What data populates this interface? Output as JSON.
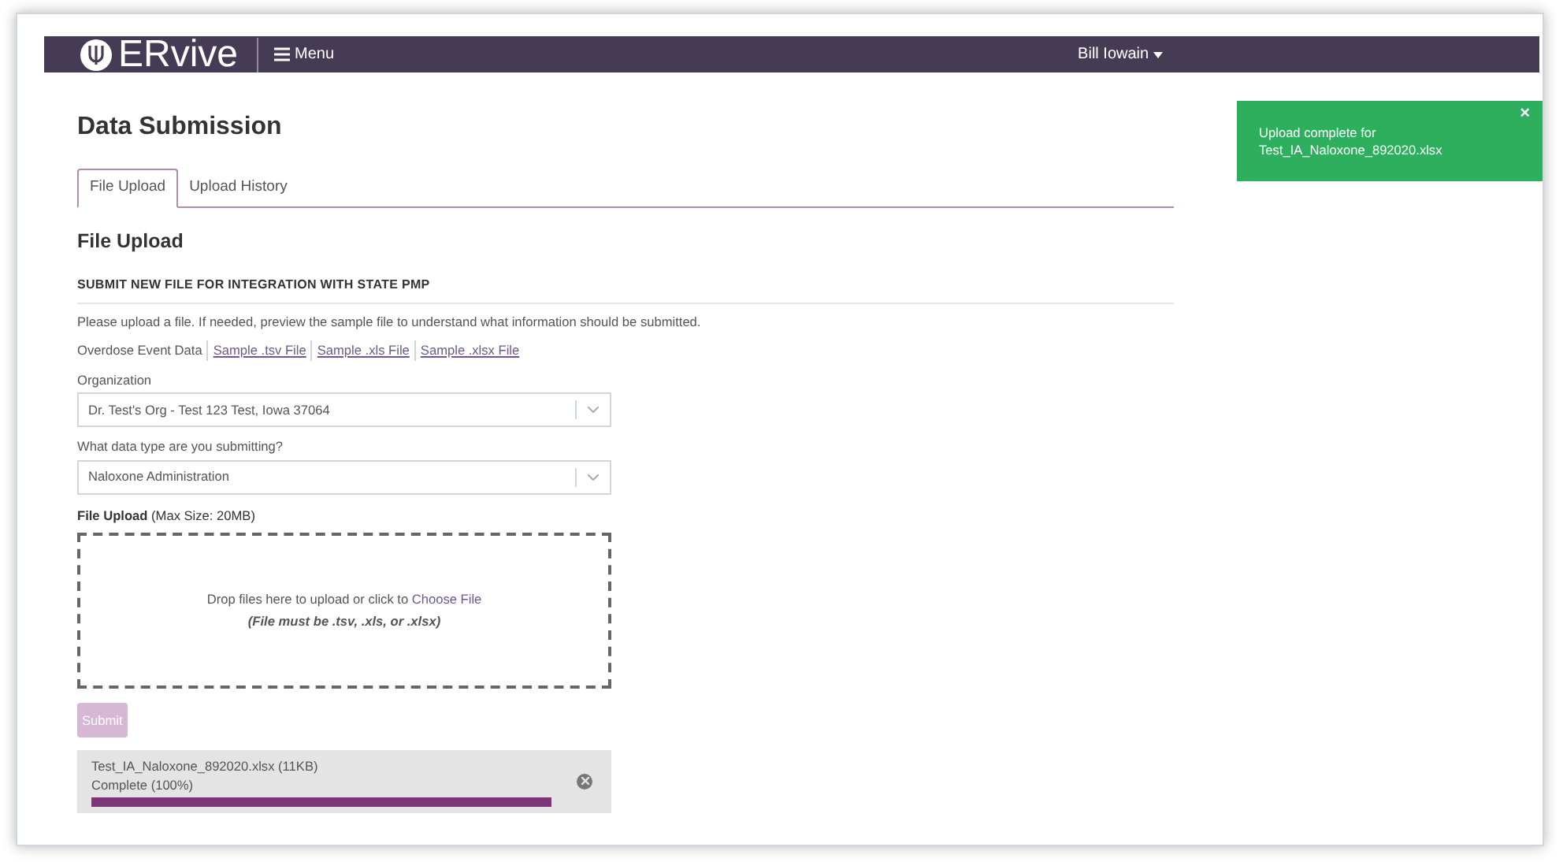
{
  "navbar": {
    "logo": "ERvive",
    "menu": "Menu",
    "user": "Bill Iowain"
  },
  "page_title": "Data Submission",
  "tabs": [
    {
      "label": "File Upload",
      "selected": true
    },
    {
      "label": "Upload History",
      "selected": false
    }
  ],
  "section_title": "File Upload",
  "subheading": "SUBMIT NEW FILE FOR INTEGRATION WITH STATE PMP",
  "intro": "Please upload a file. If needed, preview the sample file to understand what information should be submitted.",
  "sample_row": {
    "label": "Overdose Event Data",
    "links": [
      "Sample .tsv File",
      "Sample .xls File",
      "Sample .xlsx File"
    ]
  },
  "fields": [
    {
      "label": "Organization",
      "value": "Dr. Test's Org - Test 123 Test, Iowa 37064"
    },
    {
      "label": "What data type are you submitting?",
      "value": "Naloxone Administration"
    }
  ],
  "upload_label": "**File Upload** (Max Size: 20MB)",
  "dropzone": {
    "text": "Drop files here to upload or click to",
    "link": "Choose File",
    "note": "(File must be .tsv, .xls, or .xlsx)"
  },
  "submit": {
    "label": "Submit",
    "disabled": true
  },
  "upload_item": {
    "name": "Test_IA_Naloxone_892020.xlsx (11KB)",
    "status": "Complete (100%)",
    "level": 1
  },
  "toast": {
    "text": "Upload complete for Test_IA_Naloxone_892020.xlsx",
    "close": "×"
  }
}
